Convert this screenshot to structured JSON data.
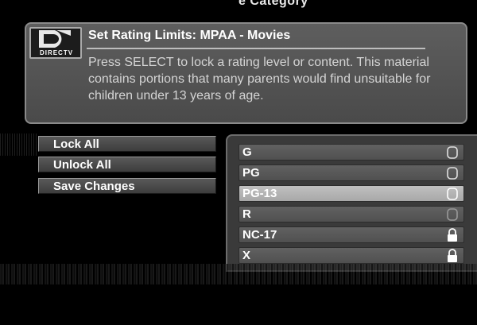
{
  "page": {
    "top_strip_text": "e Category",
    "header": {
      "logo_text": "DIRECTV",
      "title": "Set Rating Limits: MPAA - Movies",
      "description": "Press SELECT to lock a rating level or content. This material contains portions that many parents would find unsuitable for children under 13 years of age."
    },
    "actions": [
      {
        "label": "Lock All"
      },
      {
        "label": "Unlock All"
      },
      {
        "label": "Save Changes"
      }
    ],
    "ratings": [
      {
        "label": "G",
        "locked": false,
        "selected": false,
        "icon": "lock-open-icon"
      },
      {
        "label": "PG",
        "locked": false,
        "selected": false,
        "icon": "lock-open-icon"
      },
      {
        "label": "PG-13",
        "locked": false,
        "selected": true,
        "icon": "lock-open-icon"
      },
      {
        "label": "R",
        "locked": false,
        "selected": false,
        "icon": "lock-open-icon"
      },
      {
        "label": "NC-17",
        "locked": true,
        "selected": false,
        "icon": "lock-closed-icon"
      },
      {
        "label": "X",
        "locked": true,
        "selected": false,
        "icon": "lock-closed-icon"
      }
    ],
    "colors": {
      "background": "#000000",
      "panel": "#4a4a4a",
      "selected_row": "#b4b4b4",
      "text": "#ffffff"
    }
  }
}
